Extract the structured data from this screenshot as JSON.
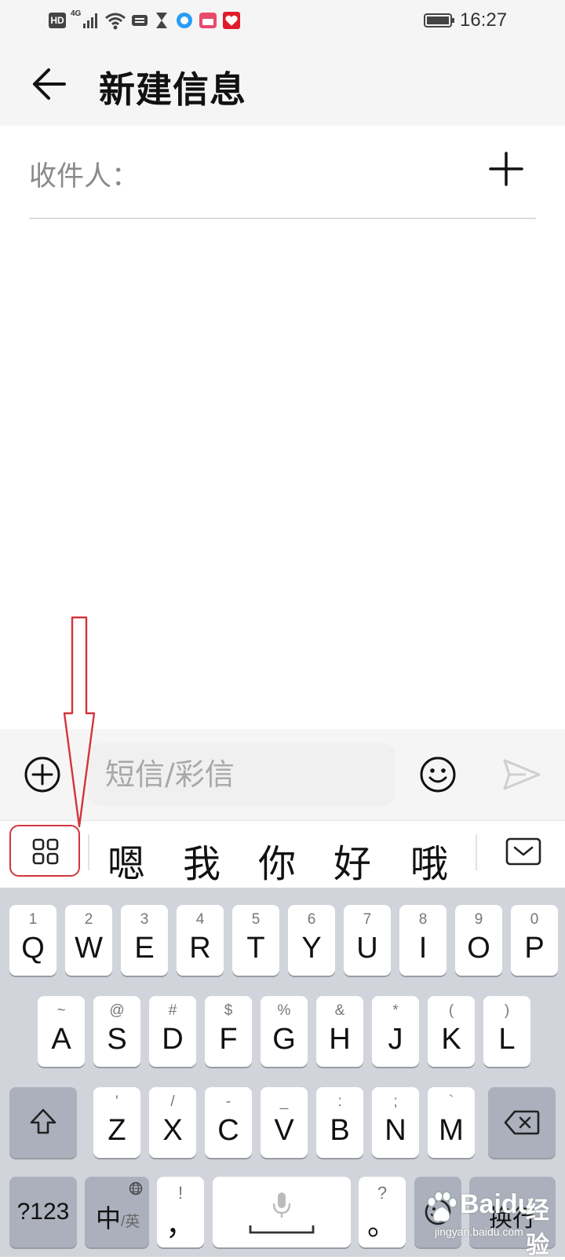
{
  "status_bar": {
    "hd": "HD",
    "network": "4G",
    "time": "16:27"
  },
  "header": {
    "title": "新建信息"
  },
  "recipient": {
    "label": "收件人："
  },
  "compose": {
    "placeholder": "短信/彩信"
  },
  "candidates": [
    "嗯",
    "我",
    "你",
    "好",
    "哦"
  ],
  "keyboard": {
    "row1": [
      {
        "main": "Q",
        "sub": "1"
      },
      {
        "main": "W",
        "sub": "2"
      },
      {
        "main": "E",
        "sub": "3"
      },
      {
        "main": "R",
        "sub": "4"
      },
      {
        "main": "T",
        "sub": "5"
      },
      {
        "main": "Y",
        "sub": "6"
      },
      {
        "main": "U",
        "sub": "7"
      },
      {
        "main": "I",
        "sub": "8"
      },
      {
        "main": "O",
        "sub": "9"
      },
      {
        "main": "P",
        "sub": "0"
      }
    ],
    "row2": [
      {
        "main": "A",
        "sub": "~"
      },
      {
        "main": "S",
        "sub": "@"
      },
      {
        "main": "D",
        "sub": "#"
      },
      {
        "main": "F",
        "sub": "$"
      },
      {
        "main": "G",
        "sub": "%"
      },
      {
        "main": "H",
        "sub": "&"
      },
      {
        "main": "J",
        "sub": "*"
      },
      {
        "main": "K",
        "sub": "("
      },
      {
        "main": "L",
        "sub": ")"
      }
    ],
    "row3": [
      {
        "main": "Z",
        "sub": "'"
      },
      {
        "main": "X",
        "sub": "/"
      },
      {
        "main": "C",
        "sub": "-"
      },
      {
        "main": "V",
        "sub": "_"
      },
      {
        "main": "B",
        "sub": ":"
      },
      {
        "main": "N",
        "sub": ";"
      },
      {
        "main": "M",
        "sub": "`"
      }
    ],
    "symbols_label": "?123",
    "lang_main": "中",
    "lang_sub": "/英",
    "comma_main": "，",
    "comma_sub": "!",
    "period_main": "。",
    "period_sub": "?",
    "enter_label": "换行"
  },
  "watermark": {
    "brand": "Baidu",
    "brand_cn": "经验",
    "site": "jingyan.baidu.com"
  },
  "colors": {
    "annotation_red": "#d3343d",
    "keyboard_bg": "#d2d4dc",
    "function_key": "#abb0bc"
  }
}
